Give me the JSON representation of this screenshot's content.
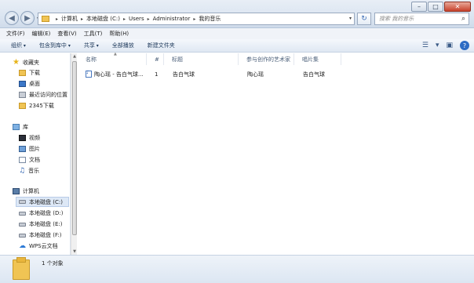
{
  "window": {
    "minimize": "–",
    "maximize": "□",
    "close": "✕",
    "back_icon": "◀",
    "forward_icon": "▶"
  },
  "address": {
    "crumbs": [
      "计算机",
      "本地磁盘 (C:)",
      "Users",
      "Administrator",
      "我的音乐"
    ],
    "refresh_icon": "↻"
  },
  "search": {
    "placeholder": "搜索 我的音乐",
    "icon": "⌕"
  },
  "menu": [
    "文件(F)",
    "编辑(E)",
    "查看(V)",
    "工具(T)",
    "帮助(H)"
  ],
  "commands": [
    "组织",
    "包含到库中",
    "共享",
    "全部播放",
    "新建文件夹"
  ],
  "command_icons": {
    "views": "☰",
    "preview": "▣",
    "help": "?"
  },
  "sidebar": {
    "favorites": {
      "label": "收藏夹",
      "items": [
        "下载",
        "桌面",
        "最近访问的位置",
        "2345下载"
      ]
    },
    "libraries": {
      "label": "库",
      "items": [
        "视频",
        "图片",
        "文档",
        "音乐"
      ]
    },
    "computer": {
      "label": "计算机",
      "items": [
        "本地磁盘 (C:)",
        "本地磁盘 (D:)",
        "本地磁盘 (E:)",
        "本地磁盘 (F:)",
        "WPS云文档"
      ]
    }
  },
  "columns": [
    "名称",
    "#",
    "标题",
    "参与创作的艺术家",
    "唱片集"
  ],
  "files": [
    {
      "name": "陶心瑶 - 告白气球...",
      "number": "1",
      "title": "告白气球",
      "artist": "陶心瑶",
      "album": "告白气球"
    }
  ],
  "status": {
    "count_text": "1 个对象"
  }
}
